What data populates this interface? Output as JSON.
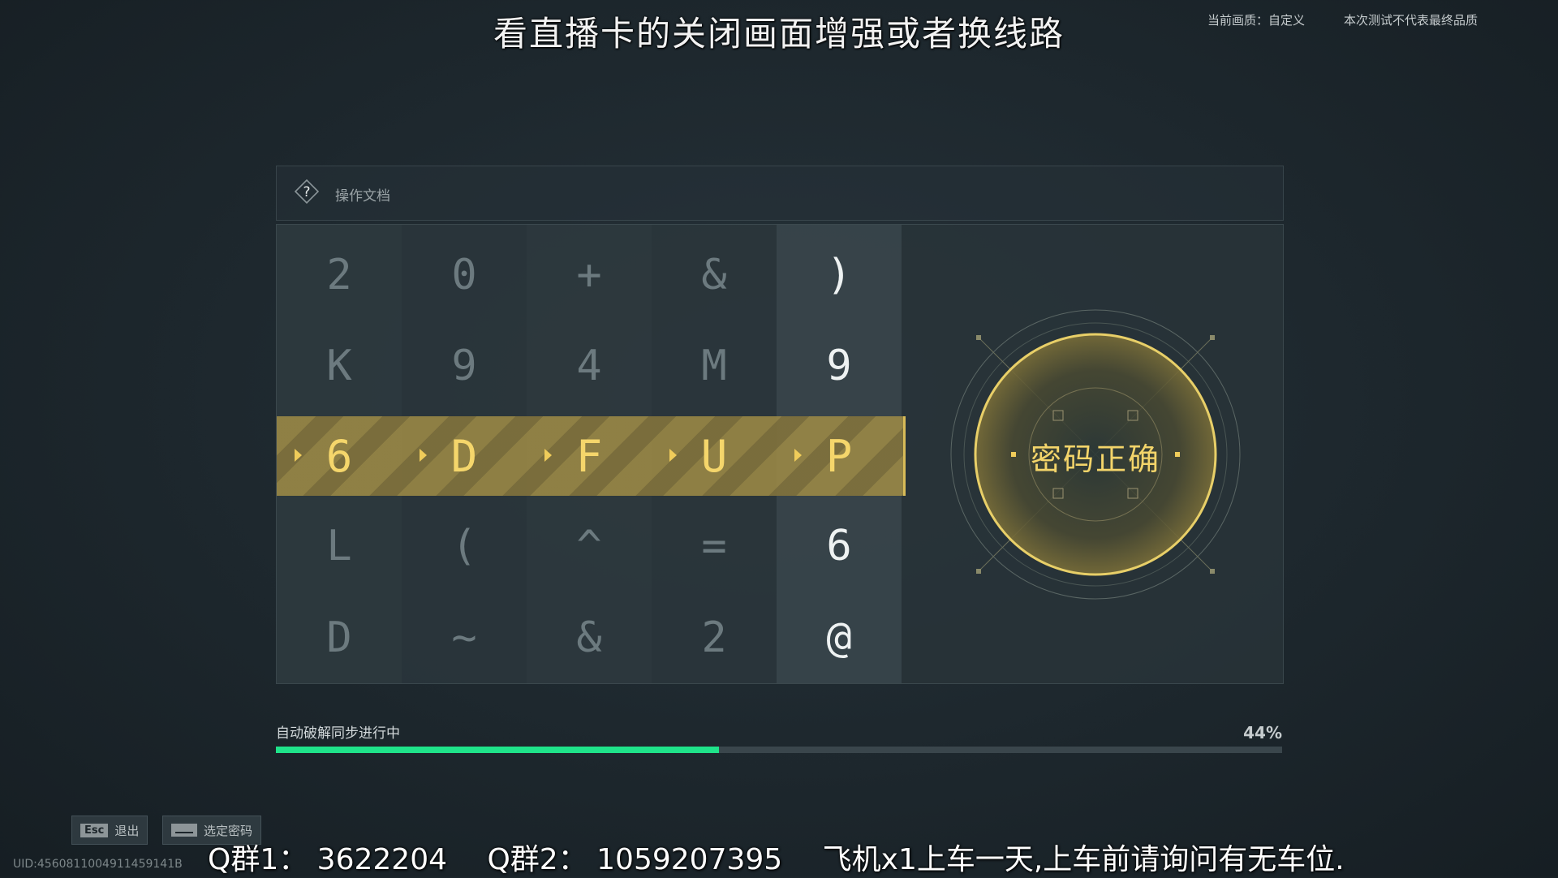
{
  "overlay": {
    "top_banner": "看直播卡的关闭画面增强或者换线路",
    "quality_label": "当前画质：自定义",
    "test_notice": "本次测试不代表最终品质",
    "bottom_q1": "Q群1： 3622204",
    "bottom_q2": "Q群2： 1059207395",
    "bottom_note": "飞机x1上车一天,上车前请询问有无车位."
  },
  "header": {
    "help_icon": "question-diamond-icon",
    "doc_label": "操作文档"
  },
  "grid": {
    "rows": [
      [
        "2",
        "0",
        "+",
        "&",
        ")"
      ],
      [
        "K",
        "9",
        "4",
        "M",
        "9"
      ],
      [
        "6",
        "D",
        "F",
        "U",
        "P"
      ],
      [
        "L",
        "(",
        "^",
        "=",
        "6"
      ],
      [
        "D",
        "~",
        "&",
        "2",
        "@"
      ]
    ],
    "selected_row_index": 2
  },
  "status": {
    "result_text": "密码正确",
    "accent_color": "#f3d46a"
  },
  "progress": {
    "label": "自动破解同步进行中",
    "percent_text": "44%",
    "value": 0.44,
    "fill_color": "#1fe38a"
  },
  "hints": [
    {
      "key": "Esc",
      "label": "退出"
    },
    {
      "key": "spacebar-icon",
      "label": "选定密码"
    }
  ],
  "uid": "UID:4560811004911459141B"
}
